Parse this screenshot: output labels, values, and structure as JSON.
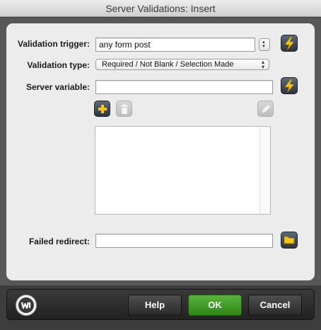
{
  "window": {
    "title": "Server Validations: Insert"
  },
  "form": {
    "validation_trigger": {
      "label": "Validation trigger:",
      "value": "any form post"
    },
    "validation_type": {
      "label": "Validation type:",
      "value": "Required / Not Blank / Selection Made"
    },
    "server_variable": {
      "label": "Server variable:",
      "value": ""
    },
    "failed_redirect": {
      "label": "Failed redirect:",
      "value": ""
    }
  },
  "list": {
    "items": []
  },
  "icons": {
    "bolt": "lightning-bolt-icon",
    "add": "plus-icon",
    "delete": "trash-icon",
    "edit": "pencil-icon",
    "folder": "folder-icon",
    "logo": "webassist-logo-icon"
  },
  "footer": {
    "help": "Help",
    "ok": "OK",
    "cancel": "Cancel"
  },
  "colors": {
    "bolt": "#f5c518",
    "ok_button": "#3f9a26",
    "panel": "#ececec"
  }
}
